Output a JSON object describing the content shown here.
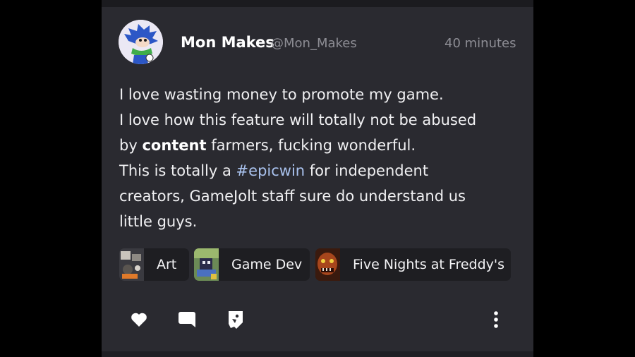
{
  "post": {
    "author_name": "Mon Makes",
    "author_handle": "@Mon_Makes",
    "timestamp": "40 minutes",
    "lines": {
      "l1": "I love wasting money to promote my game.",
      "l2": "I love how this feature will totally not be abused",
      "l3_pre": "by ",
      "l3_bold": "content",
      "l3_post": " farmers, fucking wonderful.",
      "l4_pre": "This is totally a ",
      "l4_hashtag": "#epicwin",
      "l4_post": " for independent",
      "l5": "creators, GameJolt staff sure do understand us",
      "l6": "little guys."
    }
  },
  "communities": [
    {
      "label": "Art"
    },
    {
      "label": "Game Dev"
    },
    {
      "label": "Five Nights at Freddy's"
    }
  ],
  "actions": {
    "like_icon": "heart-icon",
    "comment_icon": "comment-bubble-icon",
    "share_icon": "share-icon",
    "more_icon": "more-vertical-icon"
  },
  "colors": {
    "card_bg": "#2a2a30",
    "chip_bg": "#1e1e22",
    "hashtag": "#a9c2ee",
    "muted_text": "#8d8d94"
  }
}
